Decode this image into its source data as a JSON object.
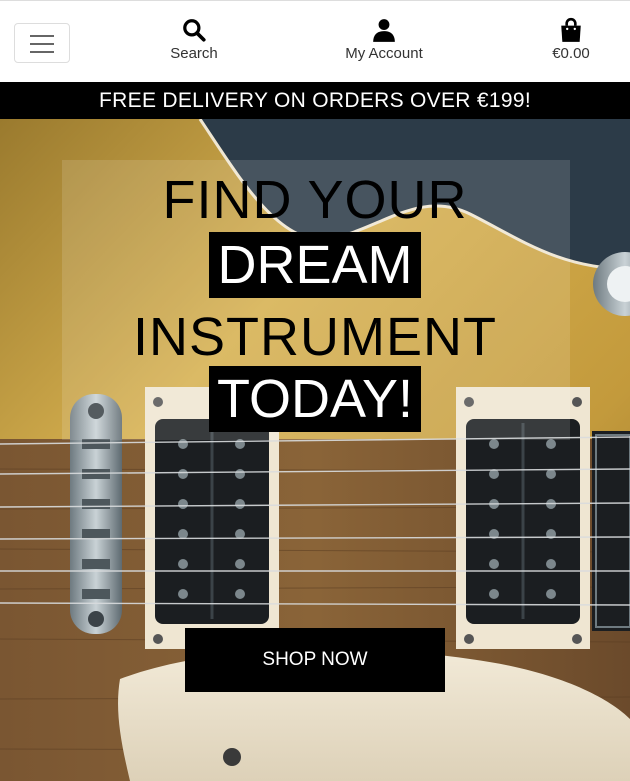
{
  "header": {
    "menu_toggle": "menu-toggle",
    "nav": [
      {
        "label": "Search",
        "icon": "search-icon"
      },
      {
        "label": "My Account",
        "icon": "user-icon"
      },
      {
        "label": "€0.00",
        "icon": "shopping-bag-icon"
      }
    ]
  },
  "banner": {
    "text": "FREE DELIVERY ON ORDERS OVER €199!"
  },
  "hero": {
    "line1": "FIND YOUR",
    "line2": "DREAM",
    "line3": "INSTRUMENT",
    "line4": "TODAY!",
    "cta_label": "SHOP NOW"
  },
  "colors": {
    "banner_bg": "#000000",
    "banner_text": "#ffffff",
    "cta_bg": "#000000",
    "cta_text": "#ffffff",
    "guitar_gold": "#c9a445",
    "guitar_cream": "#efe6d2",
    "fretboard": "#6b4a2b",
    "backdrop": "#2c3b48"
  }
}
